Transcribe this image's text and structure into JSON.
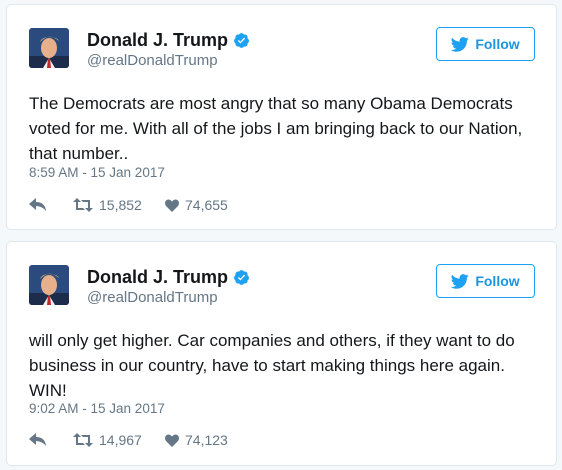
{
  "tweets": [
    {
      "author": {
        "name": "Donald J. Trump",
        "handle": "@realDonaldTrump",
        "verified": true
      },
      "follow_label": "Follow",
      "text": "The Democrats are most angry that so many Obama Democrats voted for me. With all of the jobs I am bringing back to our Nation, that number..",
      "timestamp": "8:59 AM - 15 Jan 2017",
      "retweets": "15,852",
      "likes": "74,655"
    },
    {
      "author": {
        "name": "Donald J. Trump",
        "handle": "@realDonaldTrump",
        "verified": true
      },
      "follow_label": "Follow",
      "text": "will only get higher. Car companies and others, if they want to do business in our country, have to start making things here again. WIN!",
      "timestamp": "9:02 AM - 15 Jan 2017",
      "retweets": "14,967",
      "likes": "74,123"
    }
  ],
  "colors": {
    "accent": "#1da1f2",
    "muted": "#657786",
    "text": "#14171a"
  },
  "icons": [
    "verified-badge-icon",
    "twitter-bird-icon",
    "reply-icon",
    "retweet-icon",
    "heart-icon"
  ]
}
